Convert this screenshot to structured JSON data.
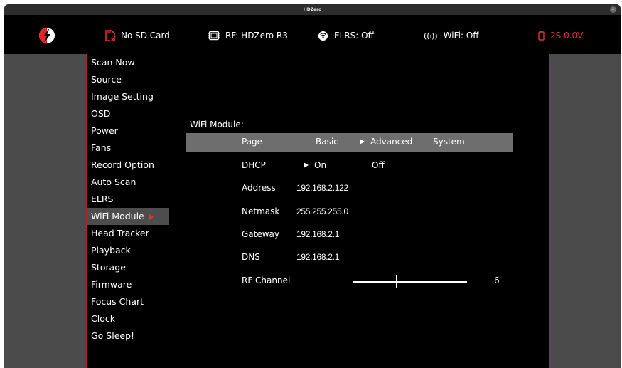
{
  "window": {
    "title": "HDZero"
  },
  "status": {
    "sd": "No SD Card",
    "rf": "RF: HDZero R3",
    "elrs": "ELRS: Off",
    "wifi": "WiFi: Off",
    "battery": "2S 0.0V"
  },
  "colors": {
    "accent": "#e03030",
    "panel": "#000000",
    "frame": "#4b4b4b",
    "page_bar": "#6e6e6e",
    "selected_row": "#4d4d4d"
  },
  "icons": [
    "hdzero-logo-icon",
    "sd-card-icon",
    "chip-icon",
    "elrs-icon",
    "wifi-icon",
    "battery-icon",
    "selection-arrow-icon"
  ],
  "menu": {
    "items": [
      {
        "label": "Scan Now"
      },
      {
        "label": "Source"
      },
      {
        "label": "Image Setting"
      },
      {
        "label": "OSD"
      },
      {
        "label": "Power"
      },
      {
        "label": "Fans"
      },
      {
        "label": "Record Option"
      },
      {
        "label": "Auto Scan"
      },
      {
        "label": "ELRS"
      },
      {
        "label": "WiFi Module",
        "selected": true
      },
      {
        "label": "Head Tracker"
      },
      {
        "label": "Playback"
      },
      {
        "label": "Storage"
      },
      {
        "label": "Firmware"
      },
      {
        "label": "Focus Chart"
      },
      {
        "label": "Clock"
      },
      {
        "label": "Go Sleep!"
      }
    ]
  },
  "wifi": {
    "heading": "WiFi Module:",
    "page": {
      "label": "Page",
      "options": [
        "Basic",
        "Advanced",
        "System"
      ],
      "selected": "Advanced"
    },
    "dhcp": {
      "label": "DHCP",
      "options": [
        "On",
        "Off"
      ],
      "selected": "On"
    },
    "address": {
      "label": "Address",
      "value": "192.168.2.122"
    },
    "netmask": {
      "label": "Netmask",
      "value": "255.255.255.0"
    },
    "gateway": {
      "label": "Gateway",
      "value": "192.168.2.1"
    },
    "dns": {
      "label": "DNS",
      "value": "192.168.2.1"
    },
    "rf_channel": {
      "label": "RF Channel",
      "value": "6"
    }
  }
}
